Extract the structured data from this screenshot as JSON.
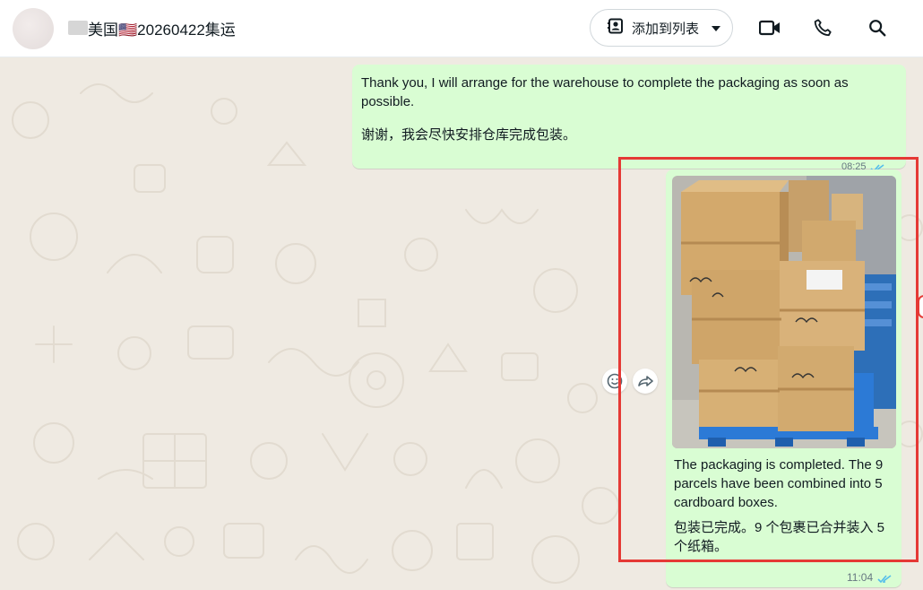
{
  "header": {
    "title": "美国🇺🇸20260422集运",
    "add_to_list_label": "添加到列表",
    "icons": [
      "contact-card-icon",
      "chevron-down-icon",
      "video-call-icon",
      "phone-icon",
      "search-icon"
    ]
  },
  "messages": [
    {
      "en": "Thank you, I will arrange for the warehouse to complete the packaging as soon as possible.",
      "zh": "谢谢，我会尽快安排仓库完成包装。",
      "time": "08:25",
      "status": "read"
    },
    {
      "image": "cardboard-boxes-on-pallet-photo",
      "en": "The packaging is completed. The 9 parcels have been combined into 5 cardboard boxes.",
      "zh": "包装已完成。9 个包裹已合并装入 5 个纸箱。",
      "time": "11:04",
      "status": "read"
    }
  ],
  "colors": {
    "outgoing_bubble": "#d9fdd3",
    "chat_background": "#efeae2",
    "read_ticks": "#53bdeb",
    "highlight_border": "#e53935"
  }
}
